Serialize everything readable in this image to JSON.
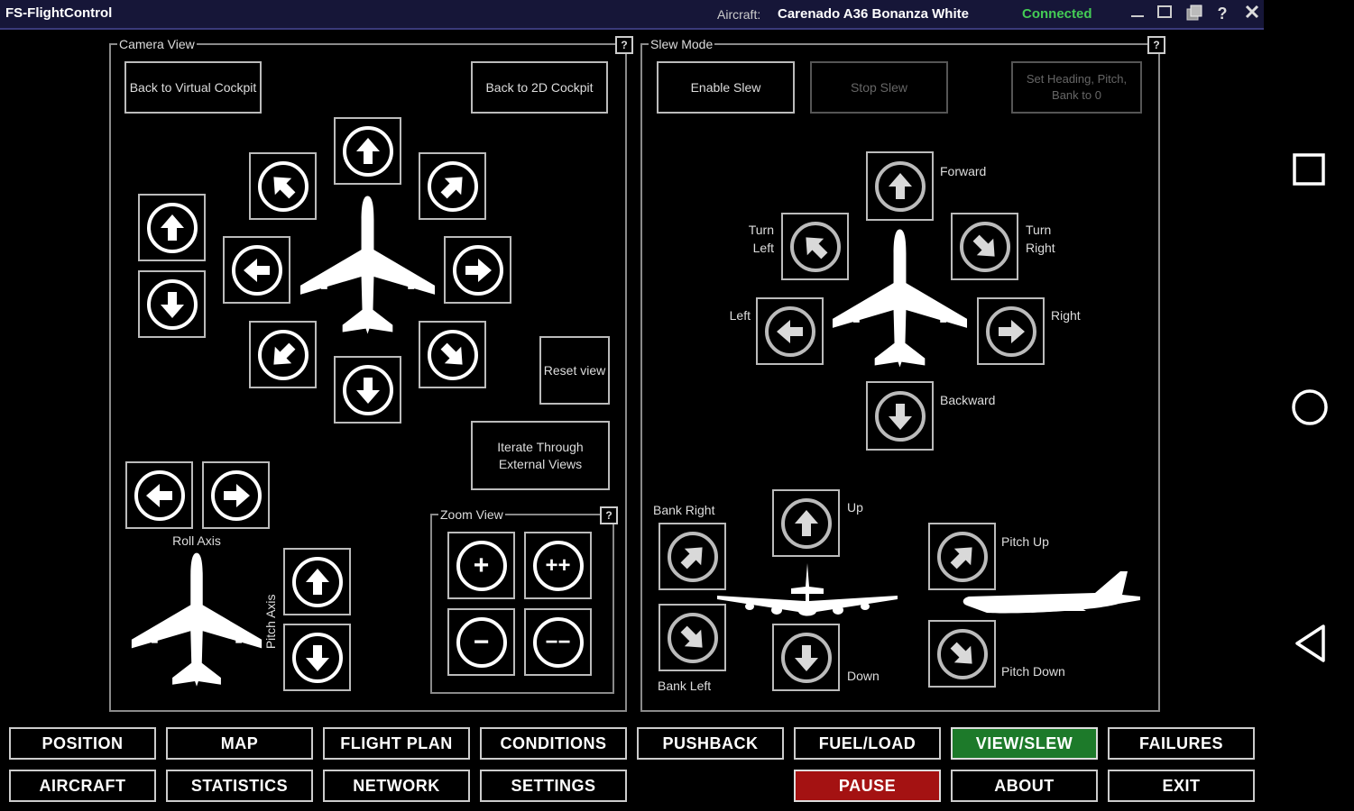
{
  "window": {
    "title": "FS-FlightControl",
    "aircraft_label": "Aircraft:",
    "aircraft_name": "Carenado A36 Bonanza White",
    "status": "Connected",
    "minimize_icon": "minimize-icon",
    "restore_icon": "restore-icon",
    "help_icon": "help-icon",
    "close_icon": "close-icon"
  },
  "camera_view": {
    "title": "Camera View",
    "help": "?",
    "back_virtual": "Back to Virtual Cockpit",
    "back_2d": "Back to 2D Cockpit",
    "reset_view": "Reset view",
    "iterate": "Iterate Through External Views",
    "roll_axis": "Roll Axis",
    "pitch_axis": "Pitch Axis",
    "zoom_view": {
      "title": "Zoom View",
      "help": "?",
      "plus": "+",
      "plus_plus": "++",
      "minus": "−",
      "minus_minus": "−−"
    }
  },
  "slew_mode": {
    "title": "Slew Mode",
    "help": "?",
    "enable": "Enable Slew",
    "stop": "Stop Slew",
    "set_heading": "Set Heading, Pitch, Bank to 0",
    "forward": "Forward",
    "turn_left": "Turn Left",
    "turn_right": "Turn Right",
    "left": "Left",
    "right": "Right",
    "backward": "Backward",
    "bank_right": "Bank Right",
    "bank_left": "Bank Left",
    "up": "Up",
    "down": "Down",
    "pitch_up": "Pitch Up",
    "pitch_down": "Pitch Down"
  },
  "nav": {
    "row1": [
      "POSITION",
      "MAP",
      "FLIGHT PLAN",
      "CONDITIONS",
      "PUSHBACK",
      "FUEL/LOAD",
      "VIEW/SLEW",
      "FAILURES"
    ],
    "row2": [
      "AIRCRAFT",
      "STATISTICS",
      "NETWORK",
      "SETTINGS",
      "",
      "PAUSE",
      "ABOUT",
      "EXIT"
    ],
    "active": "VIEW/SLEW",
    "alert": "PAUSE"
  },
  "android_nav": {
    "recents": "recents-icon",
    "home": "home-icon",
    "back": "back-icon"
  },
  "colors": {
    "titlebar": "#161638",
    "connected": "#44cc55",
    "active": "#1d7a2a",
    "pause": "#a41212"
  }
}
